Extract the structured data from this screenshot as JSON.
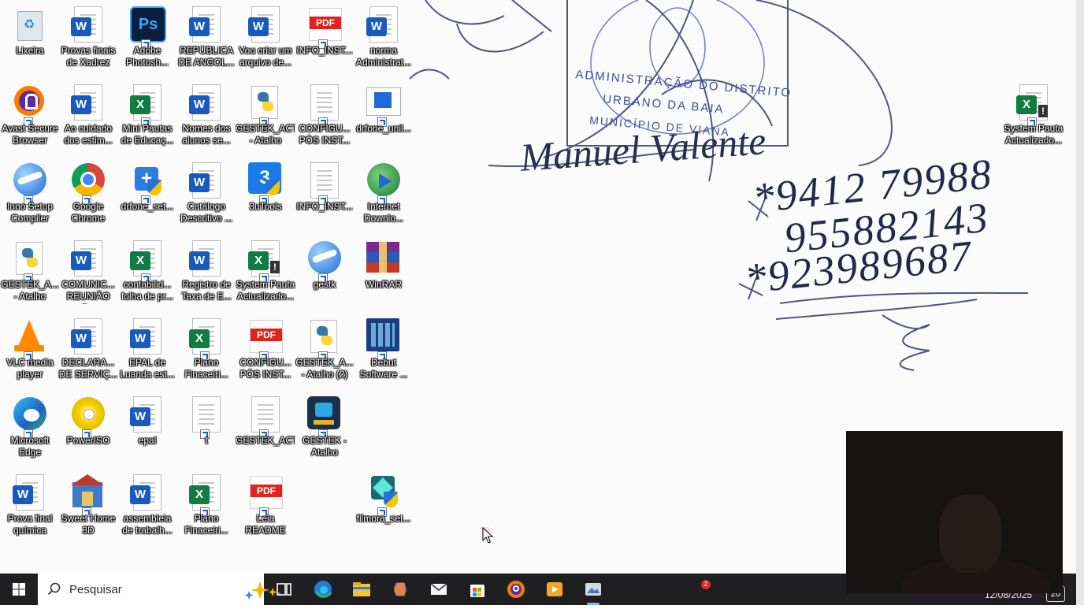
{
  "desktop": {
    "wallpaper": {
      "phone_numbers": [
        "*9412 79988",
        "955882143",
        "*923989687"
      ],
      "signature": "Manuel Valente",
      "stamp_line1": "ADMINISTRAÇÃO DO DISTRITO",
      "stamp_line2": "URBANO DA BAIA",
      "stamp_line3": "MUNICÍPIO DE VIANA"
    },
    "icons": [
      {
        "label": "Lixeira",
        "type": "recycle"
      },
      {
        "label": "Provas finais\nde Xadrez",
        "type": "word"
      },
      {
        "label": "Adobe\nPhotosh...",
        "type": "photoshop"
      },
      {
        "label": "REPÚBLICA\nDE ANGOL...",
        "type": "word"
      },
      {
        "label": "Vou criar um\narquivo de...",
        "type": "word"
      },
      {
        "label": "INFO_INST...",
        "type": "pdf"
      },
      {
        "label": "norma\nAdministrat...",
        "type": "word"
      },
      {
        "label": "Avast Secure\nBrowser",
        "type": "avast"
      },
      {
        "label": "Ao cuidado\ndos estim...",
        "type": "word"
      },
      {
        "label": "Mini Pautas\nde Educaç...",
        "type": "excel"
      },
      {
        "label": "Nomes dos\nalunos se...",
        "type": "word"
      },
      {
        "label": "GESTEK_ACT\n- Atalho",
        "type": "python"
      },
      {
        "label": "CONFIGU...\nPÓS INST...",
        "type": "text"
      },
      {
        "label": "drfone_unil...",
        "type": "window"
      },
      {
        "label": "System Pauta\nActualizado...",
        "type": "excel-warn"
      },
      {
        "label": "Inno Setup\nCompiler",
        "type": "inno"
      },
      {
        "label": "Google\nChrome",
        "type": "chrome"
      },
      {
        "label": "drfone_set...",
        "type": "setup"
      },
      {
        "label": "Catálogo\nDescritivo ...",
        "type": "word"
      },
      {
        "label": "3uTools",
        "type": "3utools"
      },
      {
        "label": "INFO_INST...",
        "type": "text"
      },
      {
        "label": "Internet\nDownlo...",
        "type": "idm"
      },
      {
        "label": "GESTEK_A...\n- Atalho",
        "type": "python"
      },
      {
        "label": "COMUNIC...\nREUNIÃO C...",
        "type": "word"
      },
      {
        "label": "contabilid...\nfolha de pr...",
        "type": "excel"
      },
      {
        "label": "Registro de\nTaxa de E...",
        "type": "word"
      },
      {
        "label": "System Pauta\nActualizado...",
        "type": "excel-warn"
      },
      {
        "label": "gestk",
        "type": "inno"
      },
      {
        "label": "WinRAR",
        "type": "winrar"
      },
      {
        "label": "VLC media\nplayer",
        "type": "vlc"
      },
      {
        "label": "DECLARA...\nDE SERVIÇ...",
        "type": "word"
      },
      {
        "label": "EPAL de\nLuanda est...",
        "type": "word"
      },
      {
        "label": "Plano\nFinaceiri...",
        "type": "excel"
      },
      {
        "label": "CONFIGU...\nPÓS INST...",
        "type": "pdf"
      },
      {
        "label": "GESTEK_A...\n- Atalho (2)",
        "type": "python"
      },
      {
        "label": "Debut\nSoftware ...",
        "type": "debut"
      },
      {
        "label": "Microsoft\nEdge",
        "type": "edge"
      },
      {
        "label": "PowerISO",
        "type": "poweriso"
      },
      {
        "label": "epal",
        "type": "word"
      },
      {
        "label": "t",
        "type": "text"
      },
      {
        "label": "GESTEK_ACT",
        "type": "blank"
      },
      {
        "label": "GESTEK -\nAtalho",
        "type": "gestek"
      },
      {
        "label": "Prova final\nquímica",
        "type": "word"
      },
      {
        "label": "Sweet Home\n3D",
        "type": "sweethome"
      },
      {
        "label": "assembleia\nde trabalh...",
        "type": "word"
      },
      {
        "label": "Plano\nFinaceiri...",
        "type": "excel"
      },
      {
        "label": "Leia README",
        "type": "pdf"
      },
      {
        "label": "filmora_set...",
        "type": "filmora"
      }
    ]
  },
  "taskbar": {
    "search_placeholder": "Pesquisar",
    "apps": [
      "task-view",
      "edge",
      "file-explorer",
      "copilot",
      "mail",
      "store",
      "avast",
      "media-player",
      "photos"
    ],
    "notification_count": "2",
    "date": "12/08/2025",
    "notification_center_count": "20"
  },
  "colors": {
    "taskbar": "#1f1f22",
    "word_blue": "#185abd",
    "excel_green": "#107c41",
    "pdf_red": "#e0231e"
  }
}
